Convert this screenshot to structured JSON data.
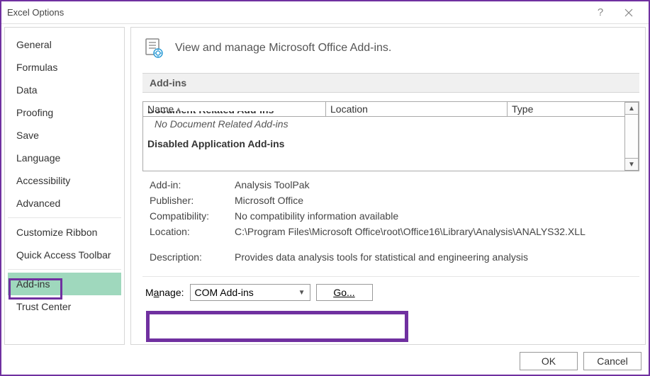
{
  "title": "Excel Options",
  "sidebar": {
    "items": [
      "General",
      "Formulas",
      "Data",
      "Proofing",
      "Save",
      "Language",
      "Accessibility",
      "Advanced"
    ],
    "items2": [
      "Customize Ribbon",
      "Quick Access Toolbar"
    ],
    "items3": [
      "Add-ins",
      "Trust Center"
    ],
    "active": "Add-ins"
  },
  "header": {
    "text": "View and manage Microsoft Office Add-ins."
  },
  "section": {
    "title": "Add-ins"
  },
  "columns": {
    "name": "Name",
    "location": "Location",
    "type": "Type"
  },
  "table": {
    "cutHeader": "Document Related Add-ins",
    "noDoc": "No Document Related Add-ins",
    "disabled": "Disabled Application Add-ins"
  },
  "details": {
    "addin_label": "Add-in:",
    "addin_value": "Analysis ToolPak",
    "publisher_label": "Publisher:",
    "publisher_value": "Microsoft Office",
    "compat_label": "Compatibility:",
    "compat_value": "No compatibility information available",
    "location_label": "Location:",
    "location_value": "C:\\Program Files\\Microsoft Office\\root\\Office16\\Library\\Analysis\\ANALYS32.XLL",
    "desc_label": "Description:",
    "desc_value": "Provides data analysis tools for statistical and engineering analysis"
  },
  "manage": {
    "label": "Manage:",
    "value": "COM Add-ins",
    "go": "Go..."
  },
  "footer": {
    "ok": "OK",
    "cancel": "Cancel"
  }
}
